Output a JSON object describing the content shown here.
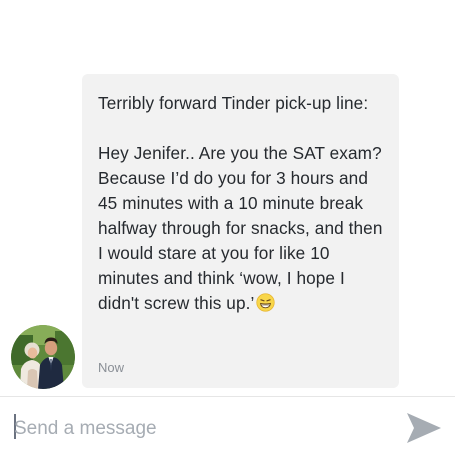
{
  "message": {
    "intro": "Terribly forward Tinder pick-up line:",
    "body": "Hey Jenifer.. Are you the SAT exam? Because I’d do you for 3 hours and 45 minutes with a 10 minute break halfway through for snacks, and then I would stare at you for like 10 minutes and think ‘wow, I hope I didn't screw this up.’",
    "emoji": "grinning-face-emoji",
    "timestamp": "Now"
  },
  "composer": {
    "placeholder": "Send a message",
    "send_icon": "send-arrow-icon"
  },
  "colors": {
    "bubble_bg": "#f2f2f2",
    "text": "#262a2f",
    "muted": "#8a8f96",
    "send_icon": "#a6acb3"
  }
}
